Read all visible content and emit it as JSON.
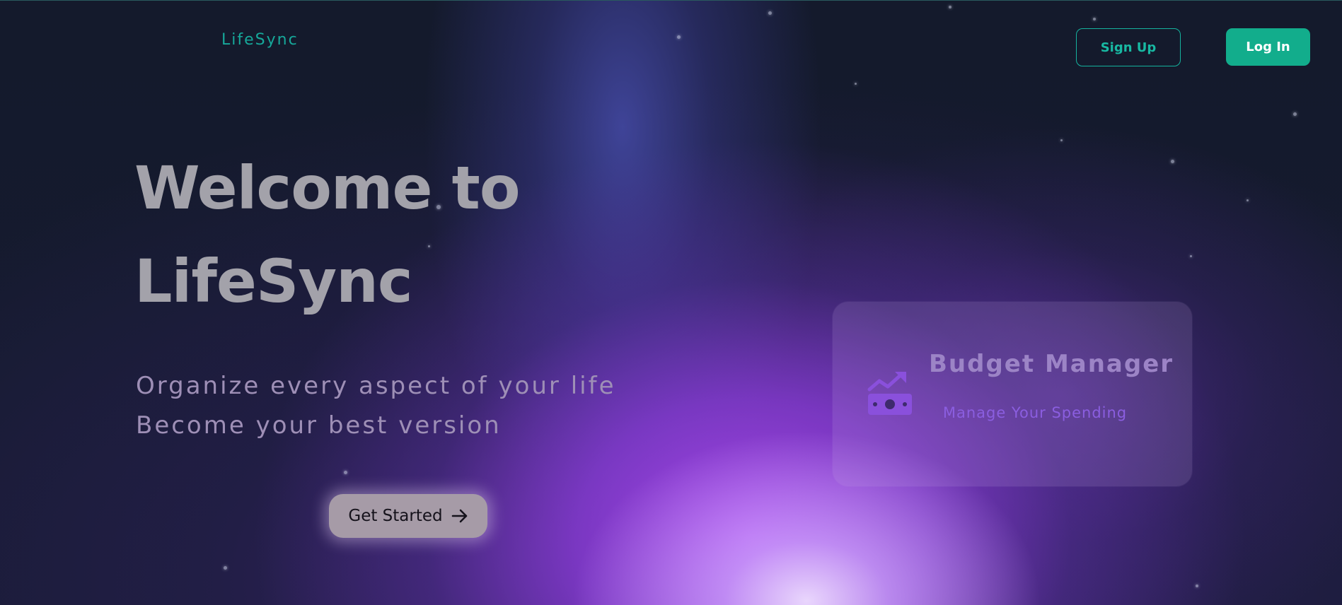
{
  "header": {
    "logo_text": "LifeSync",
    "signup_label": "Sign Up",
    "login_label": "Log In"
  },
  "hero": {
    "title_line1": "Welcome to",
    "title_line2": "LifeSync",
    "subtitle_line1": "Organize every aspect of your life",
    "subtitle_line2": "Become your best version",
    "cta_label": "Get Started",
    "cta_icon": "arrow-right-icon"
  },
  "feature_card": {
    "icon": "money-chart-icon",
    "title": "Budget Manager",
    "subtitle": "Manage Your Spending"
  },
  "colors": {
    "accent": "#12ad8c",
    "accent_outline": "#15b39e",
    "background": "#121a2b",
    "glow_purple": "#ac48f0"
  }
}
